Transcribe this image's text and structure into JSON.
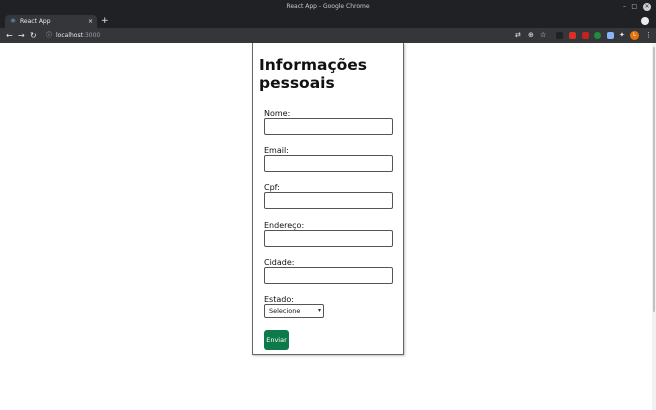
{
  "window": {
    "title": "React App - Google Chrome",
    "controls": {
      "minimize": "–",
      "maximize": "□",
      "close": "×"
    }
  },
  "tab": {
    "title": "React App",
    "close": "×",
    "new_tab": "+"
  },
  "toolbar": {
    "back": "←",
    "forward": "→",
    "reload": "↻",
    "url_host": "localhost",
    "url_port": ":3000",
    "avatar_letter": "L"
  },
  "form": {
    "heading": "Informações pessoais",
    "fields": [
      {
        "label": "Nome:",
        "value": ""
      },
      {
        "label": "Email:",
        "value": ""
      },
      {
        "label": "Cpf:",
        "value": ""
      },
      {
        "label": "Endereço:",
        "value": ""
      },
      {
        "label": "Cidade:",
        "value": ""
      }
    ],
    "state_label": "Estado:",
    "state_selected": "Selecione",
    "submit_label": "Enviar"
  },
  "colors": {
    "submit_button": "#0e7a4a",
    "chrome_dark": "#202124",
    "chrome_toolbar": "#35363a"
  }
}
